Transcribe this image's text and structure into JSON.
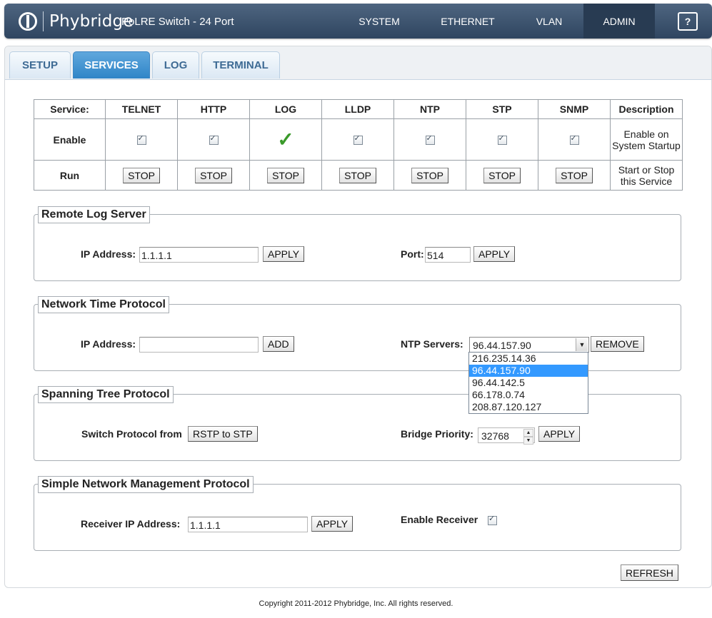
{
  "header": {
    "brand": "Phybridge",
    "product": "PoLRE Switch - 24 Port",
    "nav": [
      "SYSTEM",
      "ETHERNET",
      "VLAN",
      "ADMIN"
    ],
    "help": "?"
  },
  "tabs": [
    "SETUP",
    "SERVICES",
    "LOG",
    "TERMINAL"
  ],
  "services": {
    "service_label": "Service:",
    "enable_label": "Enable",
    "run_label": "Run",
    "description_header": "Description",
    "enable_desc": "Enable on System Startup",
    "run_desc": "Start or Stop this Service",
    "names": [
      "TELNET",
      "HTTP",
      "LOG",
      "LLDP",
      "NTP",
      "STP",
      "SNMP"
    ],
    "stop_label": "STOP"
  },
  "remote_log": {
    "legend": "Remote Log Server",
    "ip_label": "IP Address:",
    "ip_value": "1.1.1.1",
    "apply": "APPLY",
    "port_label": "Port:",
    "port_value": "514",
    "port_apply": "APPLY"
  },
  "ntp": {
    "legend": "Network Time Protocol",
    "ip_label": "IP Address:",
    "ip_value": "",
    "add": "ADD",
    "servers_label": "NTP Servers:",
    "selected": "96.44.157.90",
    "remove": "REMOVE",
    "options": [
      "216.235.14.36",
      "96.44.157.90",
      "96.44.142.5",
      "66.178.0.74",
      "208.87.120.127"
    ]
  },
  "stp": {
    "legend": "Spanning Tree Protocol",
    "switch_label": "Switch Protocol from",
    "switch_button": "RSTP to STP",
    "priority_label": "Bridge Priority:",
    "priority_value": "32768",
    "apply": "APPLY"
  },
  "snmp": {
    "legend": "Simple Network Management Protocol",
    "receiver_label": "Receiver IP Address:",
    "receiver_value": "1.1.1.1",
    "apply": "APPLY",
    "enable_receiver_label": "Enable Receiver"
  },
  "refresh": "REFRESH",
  "copyright": "Copyright 2011-2012 Phybridge, Inc. All rights reserved."
}
